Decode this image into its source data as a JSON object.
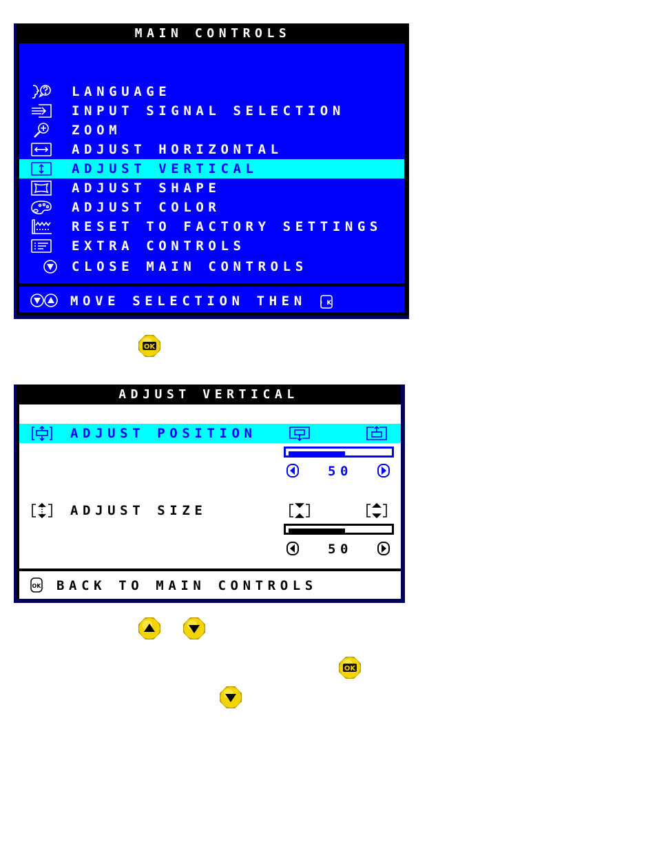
{
  "main_controls": {
    "title": "MAIN CONTROLS",
    "items": [
      {
        "icon": "language-icon",
        "label": "LANGUAGE",
        "selected": false
      },
      {
        "icon": "input-signal-icon",
        "label": "INPUT SIGNAL SELECTION",
        "selected": false
      },
      {
        "icon": "zoom-icon",
        "label": "ZOOM",
        "selected": false
      },
      {
        "icon": "horizontal-arrows-icon",
        "label": "ADJUST HORIZONTAL",
        "selected": false
      },
      {
        "icon": "vertical-arrows-icon",
        "label": "ADJUST VERTICAL",
        "selected": true
      },
      {
        "icon": "shape-icon",
        "label": "ADJUST SHAPE",
        "selected": false
      },
      {
        "icon": "palette-icon",
        "label": "ADJUST COLOR",
        "selected": false
      },
      {
        "icon": "factory-icon",
        "label": "RESET TO FACTORY SETTINGS",
        "selected": false
      },
      {
        "icon": "extra-controls-icon",
        "label": "EXTRA CONTROLS",
        "selected": false
      }
    ],
    "close_label": "CLOSE MAIN CONTROLS",
    "footer_label": "MOVE SELECTION THEN"
  },
  "adjust_vertical": {
    "title": "ADJUST VERTICAL",
    "position": {
      "label": "ADJUST POSITION",
      "value": "50",
      "level_percent": 50,
      "selected": true
    },
    "size": {
      "label": "ADJUST SIZE",
      "value": "50",
      "level_percent": 50,
      "selected": false
    },
    "footer_label": "BACK TO MAIN CONTROLS"
  },
  "buttons": {
    "ok_label": "OK",
    "up_label": "UP",
    "down_label": "DOWN"
  },
  "colors": {
    "osd_blue": "#0000ff",
    "highlight_cyan": "#00ffff",
    "button_yellow": "#f2d500"
  }
}
